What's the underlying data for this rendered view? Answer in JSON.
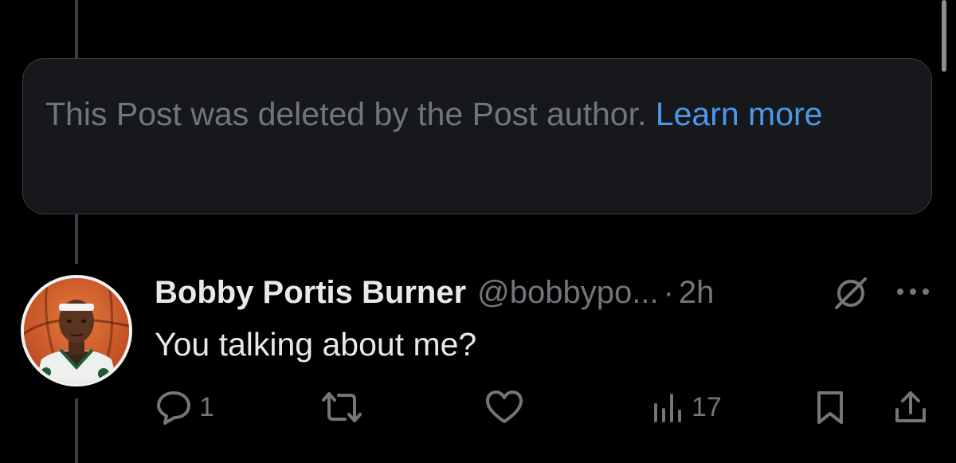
{
  "deleted_notice": {
    "text": "This Post was deleted by the Post author.",
    "link_label": "Learn more"
  },
  "post": {
    "author_name": "Bobby Portis Burner",
    "author_handle": "@bobbypo...",
    "separator": "·",
    "timestamp": "2h",
    "text": "You talking about me?",
    "avatar_icon": "avatar-image",
    "muted_icon": "muted-icon",
    "more_icon": "more-dots-icon"
  },
  "actions": {
    "reply_count": "1",
    "views_count": "17"
  },
  "colors": {
    "background": "#000000",
    "card_background": "#16181c",
    "secondary_text": "#71767b",
    "link": "#4a99e9",
    "primary_text": "#e7e9ea"
  }
}
